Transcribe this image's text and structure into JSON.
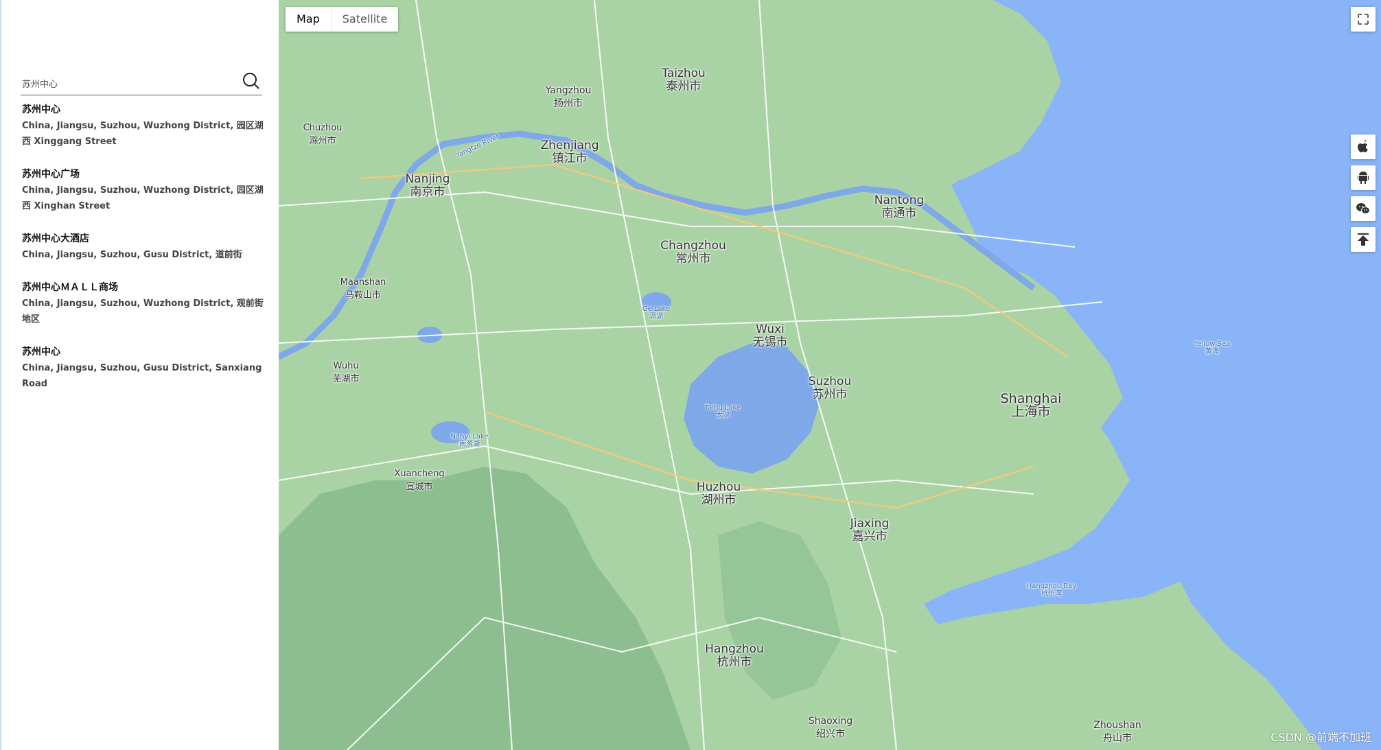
{
  "search": {
    "value": "苏州中心"
  },
  "results": [
    {
      "title": "苏州中心",
      "address": "China, Jiangsu, Suzhou, Wuzhong District, 园区湖西 Xinggang Street"
    },
    {
      "title": "苏州中心广场",
      "address": "China, Jiangsu, Suzhou, Wuzhong District, 园区湖西 Xinghan Street"
    },
    {
      "title": "苏州中心大酒店",
      "address": "China, Jiangsu, Suzhou, Gusu District, 道前街"
    },
    {
      "title": "苏州中心ＭＡＬＬ商场",
      "address": "China, Jiangsu, Suzhou, Wuzhong District, 观前街地区"
    },
    {
      "title": "苏州中心",
      "address": "China, Jiangsu, Suzhou, Gusu District, Sanxiang Road"
    }
  ],
  "map": {
    "type_map": "Map",
    "type_satellite": "Satellite",
    "cities": [
      {
        "en": "Taizhou",
        "zh": "泰州市"
      },
      {
        "en": "Yangzhou",
        "zh": "扬州市"
      },
      {
        "en": "Zhenjiang",
        "zh": "镇江市"
      },
      {
        "en": "Nanjing",
        "zh": "南京市"
      },
      {
        "en": "Nantong",
        "zh": "南通市"
      },
      {
        "en": "Changzhou",
        "zh": "常州市"
      },
      {
        "en": "Wuxi",
        "zh": "无锡市"
      },
      {
        "en": "Suzhou",
        "zh": "苏州市"
      },
      {
        "en": "Shanghai",
        "zh": "上海市"
      },
      {
        "en": "Huzhou",
        "zh": "湖州市"
      },
      {
        "en": "Jiaxing",
        "zh": "嘉兴市"
      },
      {
        "en": "Hangzhou",
        "zh": "杭州市"
      },
      {
        "en": "Shaoxing",
        "zh": "绍兴市"
      },
      {
        "en": "Zhoushan",
        "zh": "舟山市"
      },
      {
        "en": "Chuzhou",
        "zh": "滁州市"
      },
      {
        "en": "Maanshan",
        "zh": "马鞍山市"
      },
      {
        "en": "Wuhu",
        "zh": "芜湖市"
      },
      {
        "en": "Xuancheng",
        "zh": "宣城市"
      }
    ],
    "waters": [
      {
        "en": "Taihu Lake",
        "zh": "太湖"
      },
      {
        "en": "Yangtze River",
        "zh": ""
      },
      {
        "en": "Hangzhou Bay",
        "zh": "杭州湾"
      },
      {
        "en": "Yellow Sea",
        "zh": "黄海"
      },
      {
        "en": "Ge Lake",
        "zh": "滆湖"
      },
      {
        "en": "Nanyi Lake",
        "zh": "南漪湖"
      }
    ],
    "watermark": "CSDN @前端不加班"
  },
  "icons": {
    "search": "search-icon",
    "fullscreen": "fullscreen-icon",
    "apple": "apple-icon",
    "android": "android-icon",
    "wechat": "wechat-icon",
    "top": "back-to-top-icon"
  },
  "colors": {
    "land": "#a9d3a5",
    "sea": "#8ab4f8",
    "lake": "#7fa8e8"
  }
}
